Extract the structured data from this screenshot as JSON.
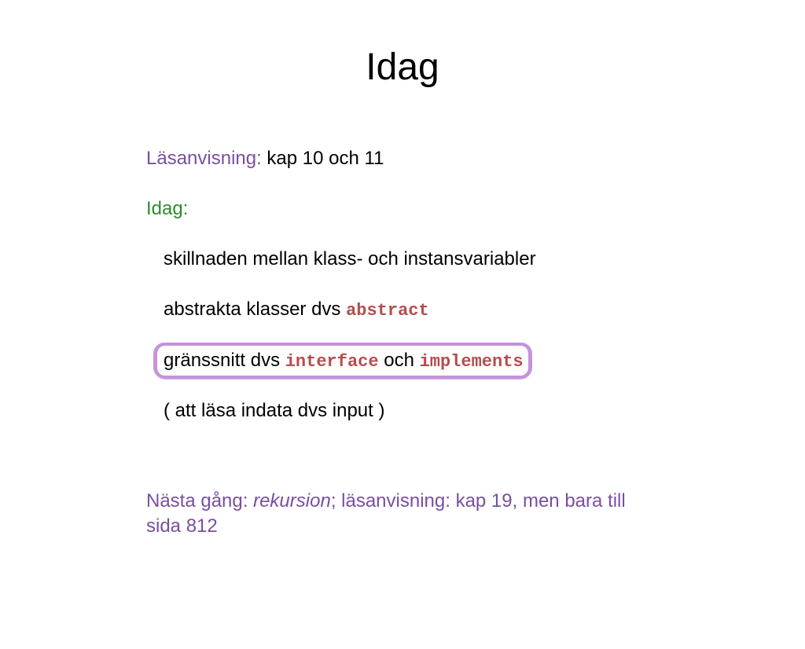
{
  "title": "Idag",
  "reading": {
    "label": "Läsanvisning:",
    "text": " kap 10 och 11"
  },
  "today_label": "Idag:",
  "items": {
    "i1": "skillnaden mellan klass- och instansvariabler",
    "i2_text": "abstrakta klasser dvs ",
    "i2_code": "abstract",
    "i3_text1": "gränssnitt dvs ",
    "i3_code1": "interface",
    "i3_text2": " och ",
    "i3_code2": "implements",
    "i4": "( att läsa indata dvs input )"
  },
  "footer": {
    "prefix": "Nästa gång: ",
    "italic": "rekursion",
    "rest": "; läsanvisning: kap 19, men bara till sida 812"
  }
}
